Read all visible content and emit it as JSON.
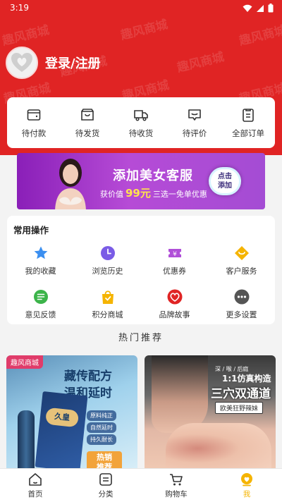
{
  "status_bar": {
    "time": "3:19"
  },
  "header": {
    "watermark": "趣风商城",
    "login_text": "登录/注册",
    "accent": "#e02424"
  },
  "orders": {
    "items": [
      {
        "label": "待付款",
        "icon": "wallet-icon"
      },
      {
        "label": "待发货",
        "icon": "package-icon"
      },
      {
        "label": "待收货",
        "icon": "truck-icon"
      },
      {
        "label": "待评价",
        "icon": "comment-icon"
      },
      {
        "label": "全部订单",
        "icon": "clipboard-icon"
      }
    ]
  },
  "banner": {
    "title": "添加美女客服",
    "sub_prefix": "获价值",
    "price": "99元",
    "sub_suffix": "三选一免单优惠",
    "cta_line1": "点击",
    "cta_line2": "添加"
  },
  "operations": {
    "title": "常用操作",
    "items": [
      {
        "label": "我的收藏",
        "icon": "star-icon",
        "color": "#3b8ff0"
      },
      {
        "label": "浏览历史",
        "icon": "clock-icon",
        "color": "#7a5ce6"
      },
      {
        "label": "优惠券",
        "icon": "coupon-icon",
        "color": "#b04fd8"
      },
      {
        "label": "客户服务",
        "icon": "service-icon",
        "color": "#f5b400"
      },
      {
        "label": "意见反馈",
        "icon": "feedback-icon",
        "color": "#3cb44a"
      },
      {
        "label": "积分商城",
        "icon": "bag-icon",
        "color": "#f5b400"
      },
      {
        "label": "品牌故事",
        "icon": "brand-heart-icon",
        "color": "#e02424"
      },
      {
        "label": "更多设置",
        "icon": "more-icon",
        "color": "#555555"
      }
    ]
  },
  "recommend": {
    "title": "热门推荐",
    "products": [
      {
        "brand_tag": "趣风商城",
        "title_line1": "藏传配方",
        "title_line2": "温和延时",
        "box_label": "久皇",
        "features": [
          "原料纯正",
          "自然延时",
          "持久耐长"
        ],
        "badge_line1": "热销",
        "badge_line2": "推荐"
      },
      {
        "top_tag": "深 / 喉 / 后庭",
        "title_line1": "1:1仿真构造",
        "title_line2": "三穴双通道",
        "tagline": "欧美狂野辣妹"
      }
    ]
  },
  "tabbar": {
    "items": [
      {
        "label": "首页",
        "icon": "home-icon"
      },
      {
        "label": "分类",
        "icon": "category-icon"
      },
      {
        "label": "购物车",
        "icon": "cart-icon"
      },
      {
        "label": "我",
        "icon": "me-icon",
        "active": true
      }
    ]
  }
}
